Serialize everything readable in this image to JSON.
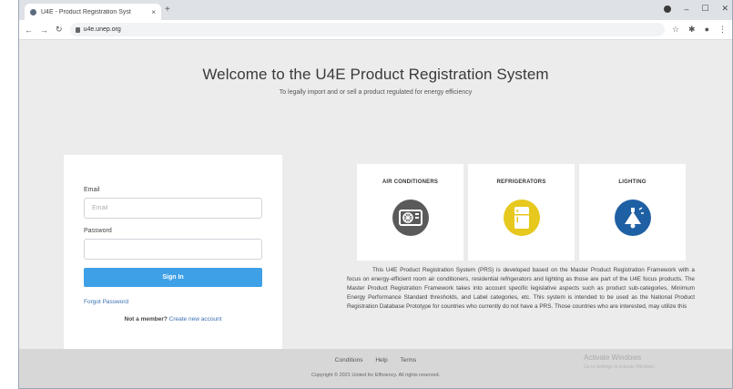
{
  "browser": {
    "tab_title": "U4E - Product Registration Syst",
    "tab_close": "×",
    "new_tab": "+",
    "url": "u4e.unep.org"
  },
  "header": {
    "title": "Welcome to the U4E Product Registration System",
    "subtitle": "To legally import and or sell a product regulated for energy efficiency"
  },
  "login": {
    "email_label": "Email",
    "email_placeholder": "Email",
    "password_label": "Password",
    "password_placeholder": "",
    "signin_label": "Sign In",
    "forgot_label": "Forgot Password",
    "member_question": "Not a member?",
    "create_account": "Create new account"
  },
  "products": [
    {
      "title": "AIR CONDITIONERS",
      "color": "#5a5a5a",
      "icon": "air-conditioner-icon"
    },
    {
      "title": "REFRIGERATORS",
      "color": "#e6c81e",
      "icon": "refrigerator-icon"
    },
    {
      "title": "LIGHTING",
      "color": "#1f5fa3",
      "icon": "light-bulb-icon"
    }
  ],
  "description": "This U4E Product Registration System (PRS) is developed based on the Master Product Registration Framework with a focus on energy-efficient room air conditioners, residential refrigerators and lighting as those are part of the U4E focus products. The Master Product Registration Framework takes into account specific legislative aspects such as product sub-categories, Minimum Energy Performance Standard thresholds, and Label categories, etc. This system is intended to be used as the National Product Registration Database Prototype for countries who currently do not have a PRS. Those countries who are interested, may utilize this",
  "footer": {
    "links": [
      "Conditions",
      "Help",
      "Terms"
    ],
    "copyright": "Copyright © 2021 United for Efficiency. All rights reserved.",
    "watermark_title": "Activate Windows",
    "watermark_sub": "Go to Settings to activate Windows."
  }
}
